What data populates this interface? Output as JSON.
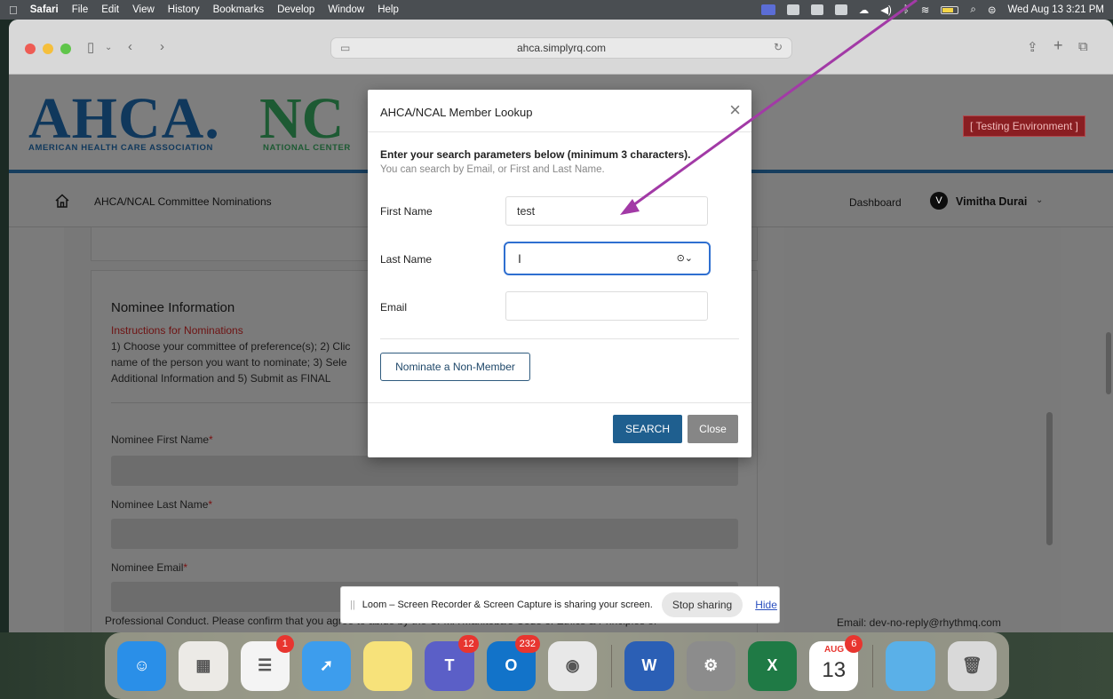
{
  "menubar": {
    "app": "Safari",
    "items": [
      "File",
      "Edit",
      "View",
      "History",
      "Bookmarks",
      "Develop",
      "Window",
      "Help"
    ],
    "datetime": "Wed Aug 13  3:21 PM"
  },
  "browser": {
    "url": "ahca.simplyrq.com"
  },
  "site": {
    "logo_main": "AHCA.",
    "logo_nc": "NC",
    "logo_sub1": "AMERICAN HEALTH CARE ASSOCIATION",
    "logo_sub2": "NATIONAL CENTER",
    "testing_badge": "[ Testing Environment ]",
    "nav_title": "AHCA/NCAL Committee Nominations",
    "dashboard": "Dashboard",
    "avatar_initial": "V",
    "user_name": "Vimitha Durai"
  },
  "nominee": {
    "heading": "Nominee Information",
    "instructions_heading": "Instructions for Nominations",
    "instructions": "1) Choose your committee of preference(s); 2) Clic name of the person you want to nominate; 3) Sele Additional Information and 5) Submit as FINAL",
    "first_label": "Nominee First Name",
    "last_label": "Nominee Last Name",
    "email_label": "Nominee Email",
    "req": "*",
    "footer_text": "Professional Conduct. Please confirm that you agree to abide by the CFMA Manitoba's Code of Ethics & Principles of",
    "footer_email": "Email:  dev-no-reply@rhythmq.com"
  },
  "modal": {
    "title": "AHCA/NCAL Member Lookup",
    "lead": "Enter your search parameters below (minimum 3 characters).",
    "sub": "You can search by Email, or First and Last Name.",
    "first_label": "First Name",
    "first_value": "test",
    "last_label": "Last Name",
    "last_value": "",
    "email_label": "Email",
    "email_value": "",
    "nonmember_button": "Nominate a Non-Member",
    "search_button": "SEARCH",
    "close_button": "Close"
  },
  "loom": {
    "text": "Loom – Screen Recorder & Screen Capture is sharing your screen.",
    "stop": "Stop sharing",
    "hide": "Hide"
  },
  "dock": {
    "apps": [
      {
        "name": "Finder",
        "glyph": "☺",
        "color": "#2a8fe8"
      },
      {
        "name": "Launchpad",
        "glyph": "▦",
        "color": "#eceae6"
      },
      {
        "name": "Reminders",
        "glyph": "☰",
        "color": "#f4f4f4",
        "badge": "1"
      },
      {
        "name": "Safari",
        "glyph": "➚",
        "color": "#3d9ded"
      },
      {
        "name": "Notes",
        "glyph": "",
        "color": "#f7e27a"
      },
      {
        "name": "Teams",
        "glyph": "T",
        "color": "#5b5fc7",
        "badge": "12"
      },
      {
        "name": "Outlook",
        "glyph": "O",
        "color": "#1273c9",
        "badge": "232"
      },
      {
        "name": "Chrome",
        "glyph": "◉",
        "color": "#e8e8e8"
      },
      {
        "name": "Word",
        "glyph": "W",
        "color": "#2b5fb5"
      },
      {
        "name": "System Settings",
        "glyph": "⚙",
        "color": "#8c8c8c"
      },
      {
        "name": "Excel",
        "glyph": "X",
        "color": "#1f7a45"
      },
      {
        "name": "Calendar",
        "glyph": "13",
        "color": "#ffffff",
        "badge": "6",
        "month": "AUG"
      },
      {
        "name": "Folder",
        "glyph": "",
        "color": "#5ab0e8"
      },
      {
        "name": "Trash",
        "glyph": "🗑",
        "color": "#d9d9d9"
      }
    ]
  },
  "colors": {
    "accent": "#1f5f8f",
    "annotation_arrow": "#a23aa6",
    "focus_ring": "#2f6fd0",
    "testing_badge": "#8a1e22"
  }
}
